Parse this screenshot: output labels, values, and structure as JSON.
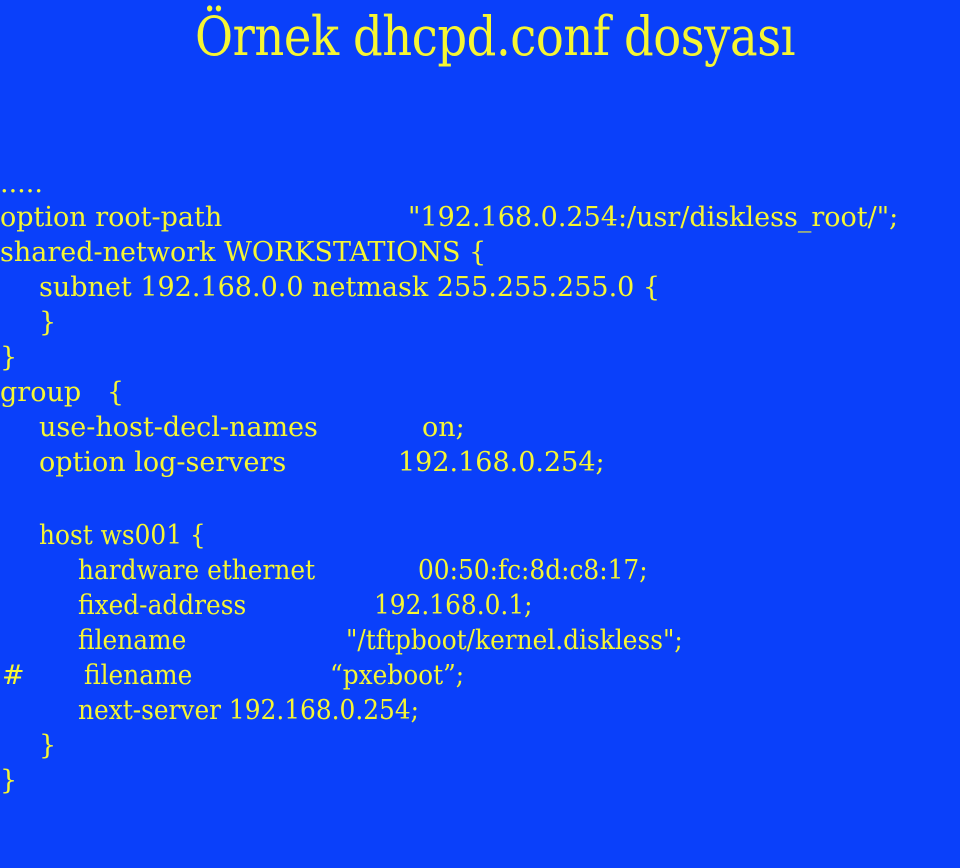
{
  "slide": {
    "title": "Örnek dhcpd.conf dosyası",
    "background_color": "#0a40fa",
    "text_color": "#f6f633"
  },
  "code": {
    "lines": [
      {
        "key": "",
        "value": "....."
      },
      {
        "key": "option root-path",
        "value": "\"192.168.0.254:/usr/diskless_root/\";"
      },
      {
        "key": "shared-network WORKSTATIONS {",
        "value": ""
      },
      {
        "key": "subnet 192.168.0.0 netmask 255.255.255.0 {",
        "value": ""
      },
      {
        "key": "}",
        "value": ""
      },
      {
        "key": "}",
        "value": ""
      },
      {
        "key": "group   {",
        "value": ""
      },
      {
        "key": "use-host-decl-names",
        "value": "on;"
      },
      {
        "key": "option log-servers",
        "value": "192.168.0.254;"
      },
      {
        "key": "host ws001 {",
        "value": ""
      },
      {
        "key": "hardware ethernet",
        "value": "00:50:fc:8d:c8:17;"
      },
      {
        "key": "fixed-address",
        "value": "192.168.0.1;"
      },
      {
        "key": "filename",
        "value": "\"/tftpboot/kernel.diskless\";"
      },
      {
        "prefix": "#",
        "key": "filename",
        "value": "“pxeboot”;"
      },
      {
        "key": "next-server 192.168.0.254;",
        "value": ""
      },
      {
        "key": "}",
        "value": ""
      },
      {
        "key": "}",
        "value": ""
      }
    ]
  }
}
